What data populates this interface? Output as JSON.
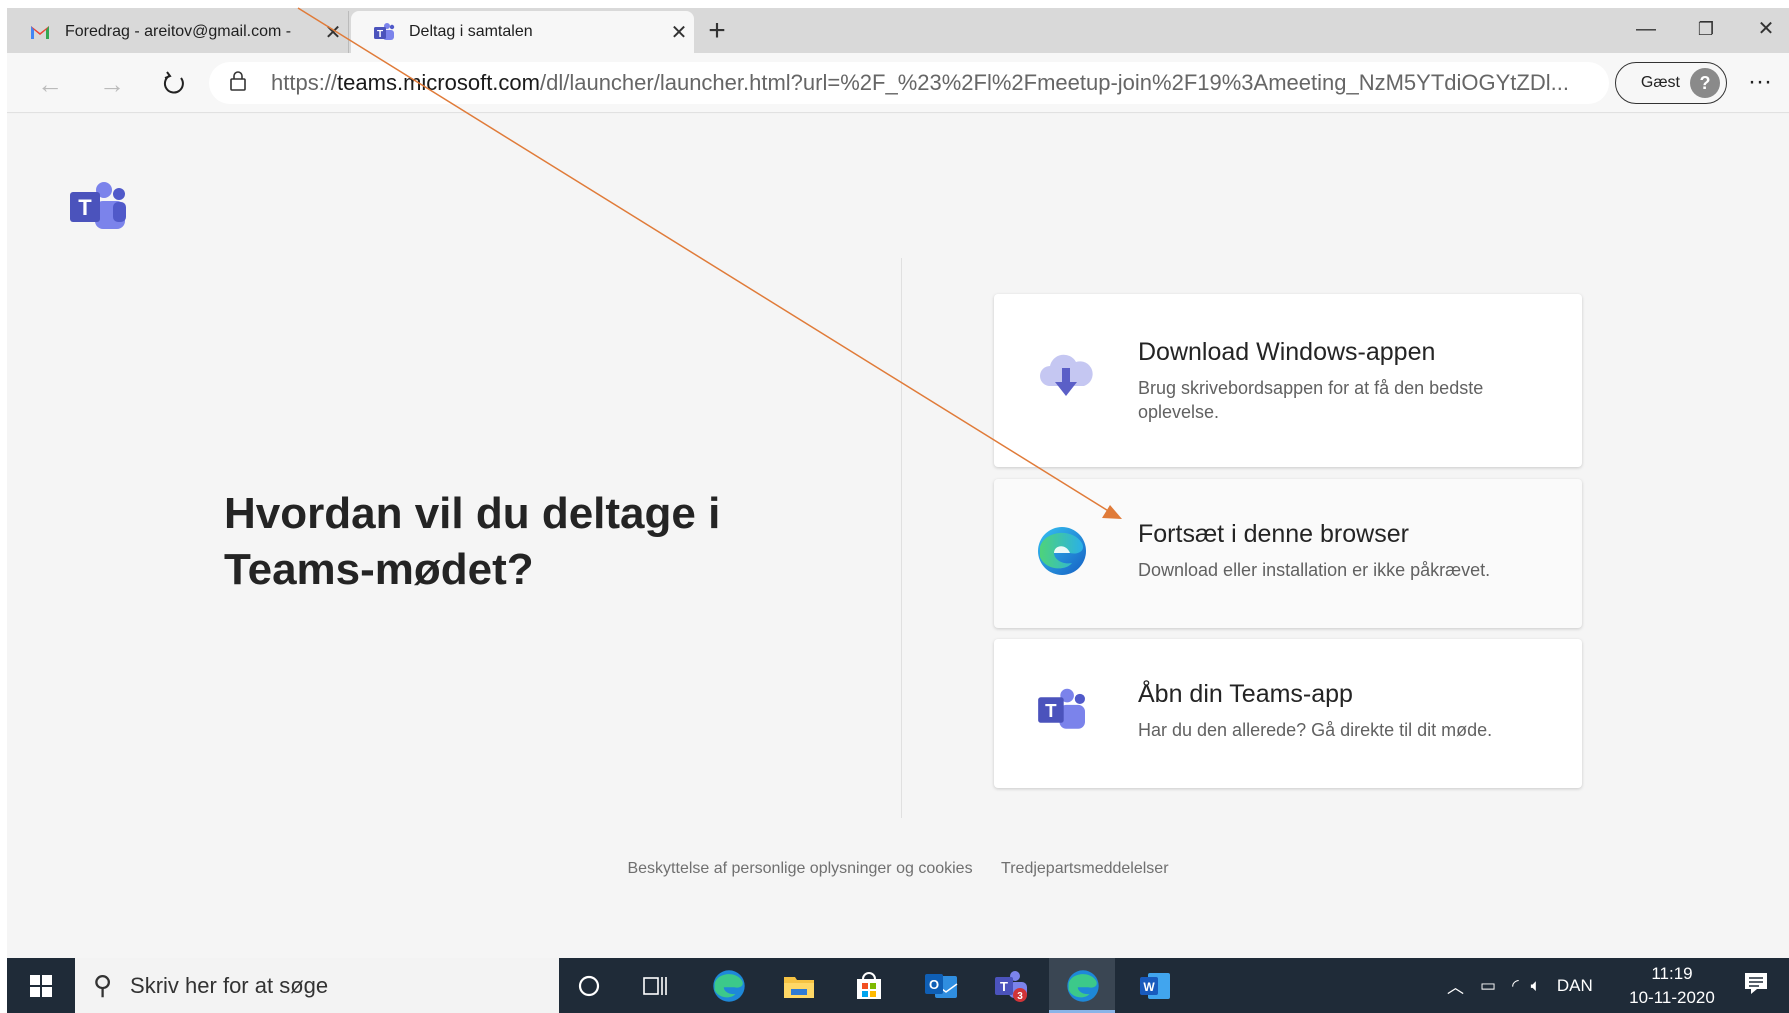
{
  "tabs": [
    {
      "title": "Foredrag - areitov@gmail.com -",
      "close": "✕"
    },
    {
      "title": "Deltag i samtalen",
      "close": "✕"
    }
  ],
  "address": {
    "scheme": "https://",
    "host": "teams.microsoft.com",
    "path": "/dl/launcher/launcher.html?url=%2F_%23%2Fl%2Fmeetup-join%2F19%3Ameeting_NzM5YTdiOGYtZDl..."
  },
  "guest": {
    "label": "Gæst"
  },
  "heading": "Hvordan vil du deltage i Teams-mødet?",
  "options": [
    {
      "title": "Download Windows-appen",
      "desc": "Brug skrivebordsappen for at få den bedste oplevelse."
    },
    {
      "title": "Fortsæt i denne browser",
      "desc": "Download eller installation er ikke påkrævet."
    },
    {
      "title": "Åbn din Teams-app",
      "desc": "Har du den allerede? Gå direkte til dit møde."
    }
  ],
  "footer": {
    "privacy": "Beskyttelse af personlige oplysninger og cookies",
    "third_party": "Tredjepartsmeddelelser"
  },
  "taskbar": {
    "search_placeholder": "Skriv her for at søge",
    "teams_badge": "3",
    "language": "DAN",
    "time": "11:19",
    "date": "10-11-2020"
  },
  "colors": {
    "teams_purple": "#5b5fc7",
    "annotation_arrow": "#e07b39",
    "taskbar": "#1f2b38"
  }
}
